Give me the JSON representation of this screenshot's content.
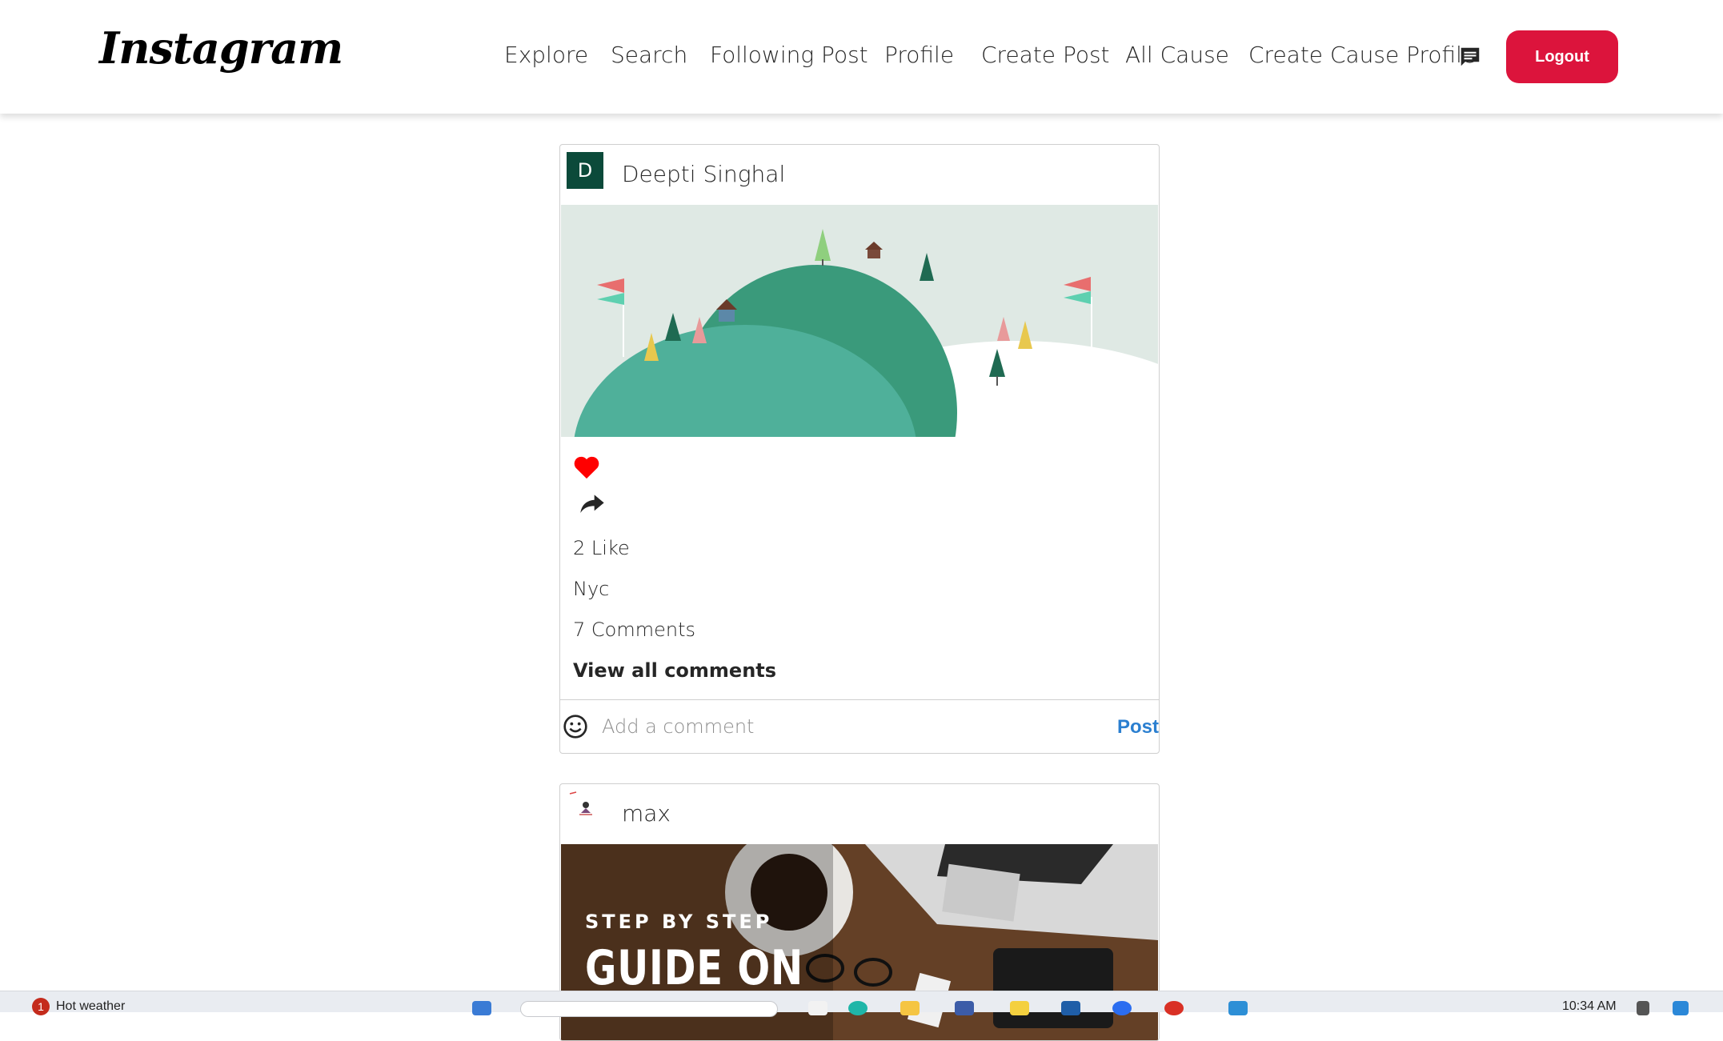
{
  "app": {
    "logo_text": "Instagram"
  },
  "nav": {
    "links": [
      "Explore",
      "Search",
      "Following Post",
      "Profile",
      "Create Post",
      "All Cause",
      "Create Cause Profile"
    ],
    "message_icon": "chat-bubble-icon",
    "logout_label": "Logout"
  },
  "posts": [
    {
      "avatar_letter": "D",
      "username": "Deepti Singhal",
      "image": "green-hills-illustration",
      "liked": true,
      "likes_text": "2 Like",
      "caption": "Nyc",
      "comments_text": "7 Comments",
      "view_all_label": "View all comments",
      "comment_placeholder": "Add a comment",
      "post_label": "Post"
    },
    {
      "avatar_letter": "",
      "username": "max",
      "image": "desk-laptop-coffee-photo",
      "image_text_line1": "STEP BY STEP",
      "image_text_line2": "GUIDE ON"
    }
  ],
  "taskbar": {
    "weather_badge": "1",
    "weather_text": "Hot weather",
    "clock": "10:34 AM"
  },
  "colors": {
    "logout_bg": "#dc143c",
    "like_red": "#ff0000",
    "post_blue": "#2b7fd0",
    "avatar_green": "#0b4a3a"
  }
}
